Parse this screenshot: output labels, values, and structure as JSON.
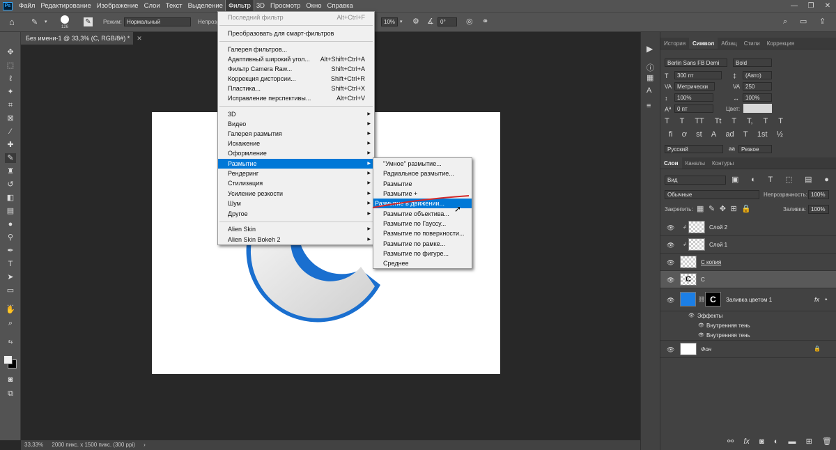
{
  "app": {
    "logo": "Ps"
  },
  "menubar": {
    "items": [
      "Файл",
      "Редактирование",
      "Изображение",
      "Слои",
      "Текст",
      "Выделение",
      "Фильтр",
      "3D",
      "Просмотр",
      "Окно",
      "Справка"
    ],
    "active_index": 6
  },
  "options": {
    "brush_size": "126",
    "mode_label": "Режим:",
    "mode_value": "Нормальный",
    "opacity_label": "Непрозр",
    "smoothing_value": "10%",
    "angle_value": "0°"
  },
  "document": {
    "tab_title": "Без имени-1 @ 33,3% (C, RGB/8#) *"
  },
  "status": {
    "zoom": "33,33%",
    "size": "2000 пикс. x 1500 пикс. (300 ppi)"
  },
  "filter_menu": {
    "items": [
      {
        "label": "Последний фильтр",
        "shortcut": "Alt+Ctrl+F",
        "disabled": true
      },
      {
        "label": "Преобразовать для смарт-фильтров"
      },
      {
        "label": "Галерея фильтров..."
      },
      {
        "label": "Адаптивный широкий угол...",
        "shortcut": "Alt+Shift+Ctrl+A"
      },
      {
        "label": "Фильтр Camera Raw...",
        "shortcut": "Shift+Ctrl+A"
      },
      {
        "label": "Коррекция дисторсии...",
        "shortcut": "Shift+Ctrl+R"
      },
      {
        "label": "Пластика...",
        "shortcut": "Shift+Ctrl+X"
      },
      {
        "label": "Исправление перспективы...",
        "shortcut": "Alt+Ctrl+V"
      },
      {
        "label": "3D",
        "submenu": true
      },
      {
        "label": "Видео",
        "submenu": true
      },
      {
        "label": "Галерея размытия",
        "submenu": true
      },
      {
        "label": "Искажение",
        "submenu": true
      },
      {
        "label": "Оформление",
        "submenu": true
      },
      {
        "label": "Размытие",
        "submenu": true,
        "highlighted": true
      },
      {
        "label": "Рендеринг",
        "submenu": true
      },
      {
        "label": "Стилизация",
        "submenu": true
      },
      {
        "label": "Усиление резкости",
        "submenu": true
      },
      {
        "label": "Шум",
        "submenu": true
      },
      {
        "label": "Другое",
        "submenu": true
      },
      {
        "label": "Alien Skin",
        "submenu": true
      },
      {
        "label": "Alien Skin Bokeh 2",
        "submenu": true
      }
    ]
  },
  "blur_menu": {
    "items": [
      {
        "label": "\"Умное\" размытие..."
      },
      {
        "label": "Радиальное размытие..."
      },
      {
        "label": "Размытие"
      },
      {
        "label": "Размытие +"
      },
      {
        "label": "Размытие в движении...",
        "highlighted": true
      },
      {
        "label": "Размытие объектива..."
      },
      {
        "label": "Размытие по Гауссу..."
      },
      {
        "label": "Размытие по поверхности..."
      },
      {
        "label": "Размытие по рамке..."
      },
      {
        "label": "Размытие по фигуре..."
      },
      {
        "label": "Среднее"
      }
    ]
  },
  "panels": {
    "top_tabs": [
      "История",
      "Символ",
      "Абзац",
      "Стили",
      "Коррекция"
    ],
    "top_active": 1,
    "character": {
      "font_family": "Berlin Sans FB Demi",
      "font_style": "Bold",
      "size": "300 пт",
      "leading": "(Авто)",
      "kerning": "Метрически",
      "tracking": "250",
      "vscale": "100%",
      "hscale": "100%",
      "baseline": "0 пт",
      "color_label": "Цвет:",
      "language": "Русский",
      "antialias": "Резкое",
      "aa_label": "aa",
      "style_buttons": [
        "T",
        "T",
        "TT",
        "Tt",
        "T",
        "T,",
        "T",
        "T"
      ],
      "ot_buttons": [
        "fi",
        "ơ",
        "st",
        "A",
        "ad",
        "T",
        "1st",
        "½"
      ]
    },
    "layer_tabs": [
      "Слои",
      "Каналы",
      "Контуры"
    ],
    "layer_active": 0,
    "layers": {
      "filter_kind": "Вид",
      "blend_mode": "Обычные",
      "opacity_label": "Непрозрачность:",
      "opacity": "100%",
      "lock_label": "Закрепить:",
      "fill_label": "Заливка:",
      "fill": "100%",
      "items": [
        {
          "name": "Слой 2"
        },
        {
          "name": "Слой 1"
        },
        {
          "name": "С копия"
        },
        {
          "name": "С"
        },
        {
          "name": "Заливка цветом 1",
          "fx": "fx"
        },
        {
          "name": "Эффекты"
        },
        {
          "name": "Внутренняя тень"
        },
        {
          "name": "Внутренняя тень"
        },
        {
          "name": "Фон"
        }
      ]
    }
  },
  "colors": {
    "menu_highlight": "#0078d7",
    "fill_layer": "#1c7fe6",
    "shape_blue": "#1a6fcf",
    "annotation_red": "#d42a2a"
  }
}
